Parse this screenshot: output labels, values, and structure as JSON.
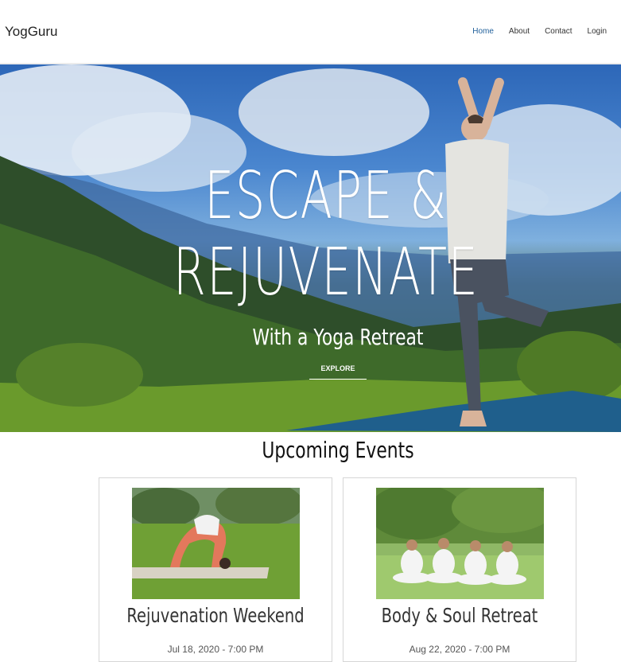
{
  "header": {
    "brand": "YogGuru",
    "nav": [
      {
        "label": "Home",
        "active": true
      },
      {
        "label": "About",
        "active": false
      },
      {
        "label": "Contact",
        "active": false
      },
      {
        "label": "Login",
        "active": false
      }
    ]
  },
  "hero": {
    "title_line1": "ESCAPE &",
    "title_line2": "REJUVENATE",
    "subtitle": "With a Yoga Retreat",
    "cta": "EXPLORE"
  },
  "events": {
    "heading": "Upcoming Events",
    "items": [
      {
        "title": "Rejuvenation Weekend",
        "date": "Jul 18, 2020 - 7:00 PM"
      },
      {
        "title": "Body & Soul Retreat",
        "date": "Aug 22, 2020 - 7:00 PM"
      }
    ]
  },
  "colors": {
    "accent": "#1f5f9a",
    "text": "#222222",
    "card_border": "#d6d6d6"
  }
}
